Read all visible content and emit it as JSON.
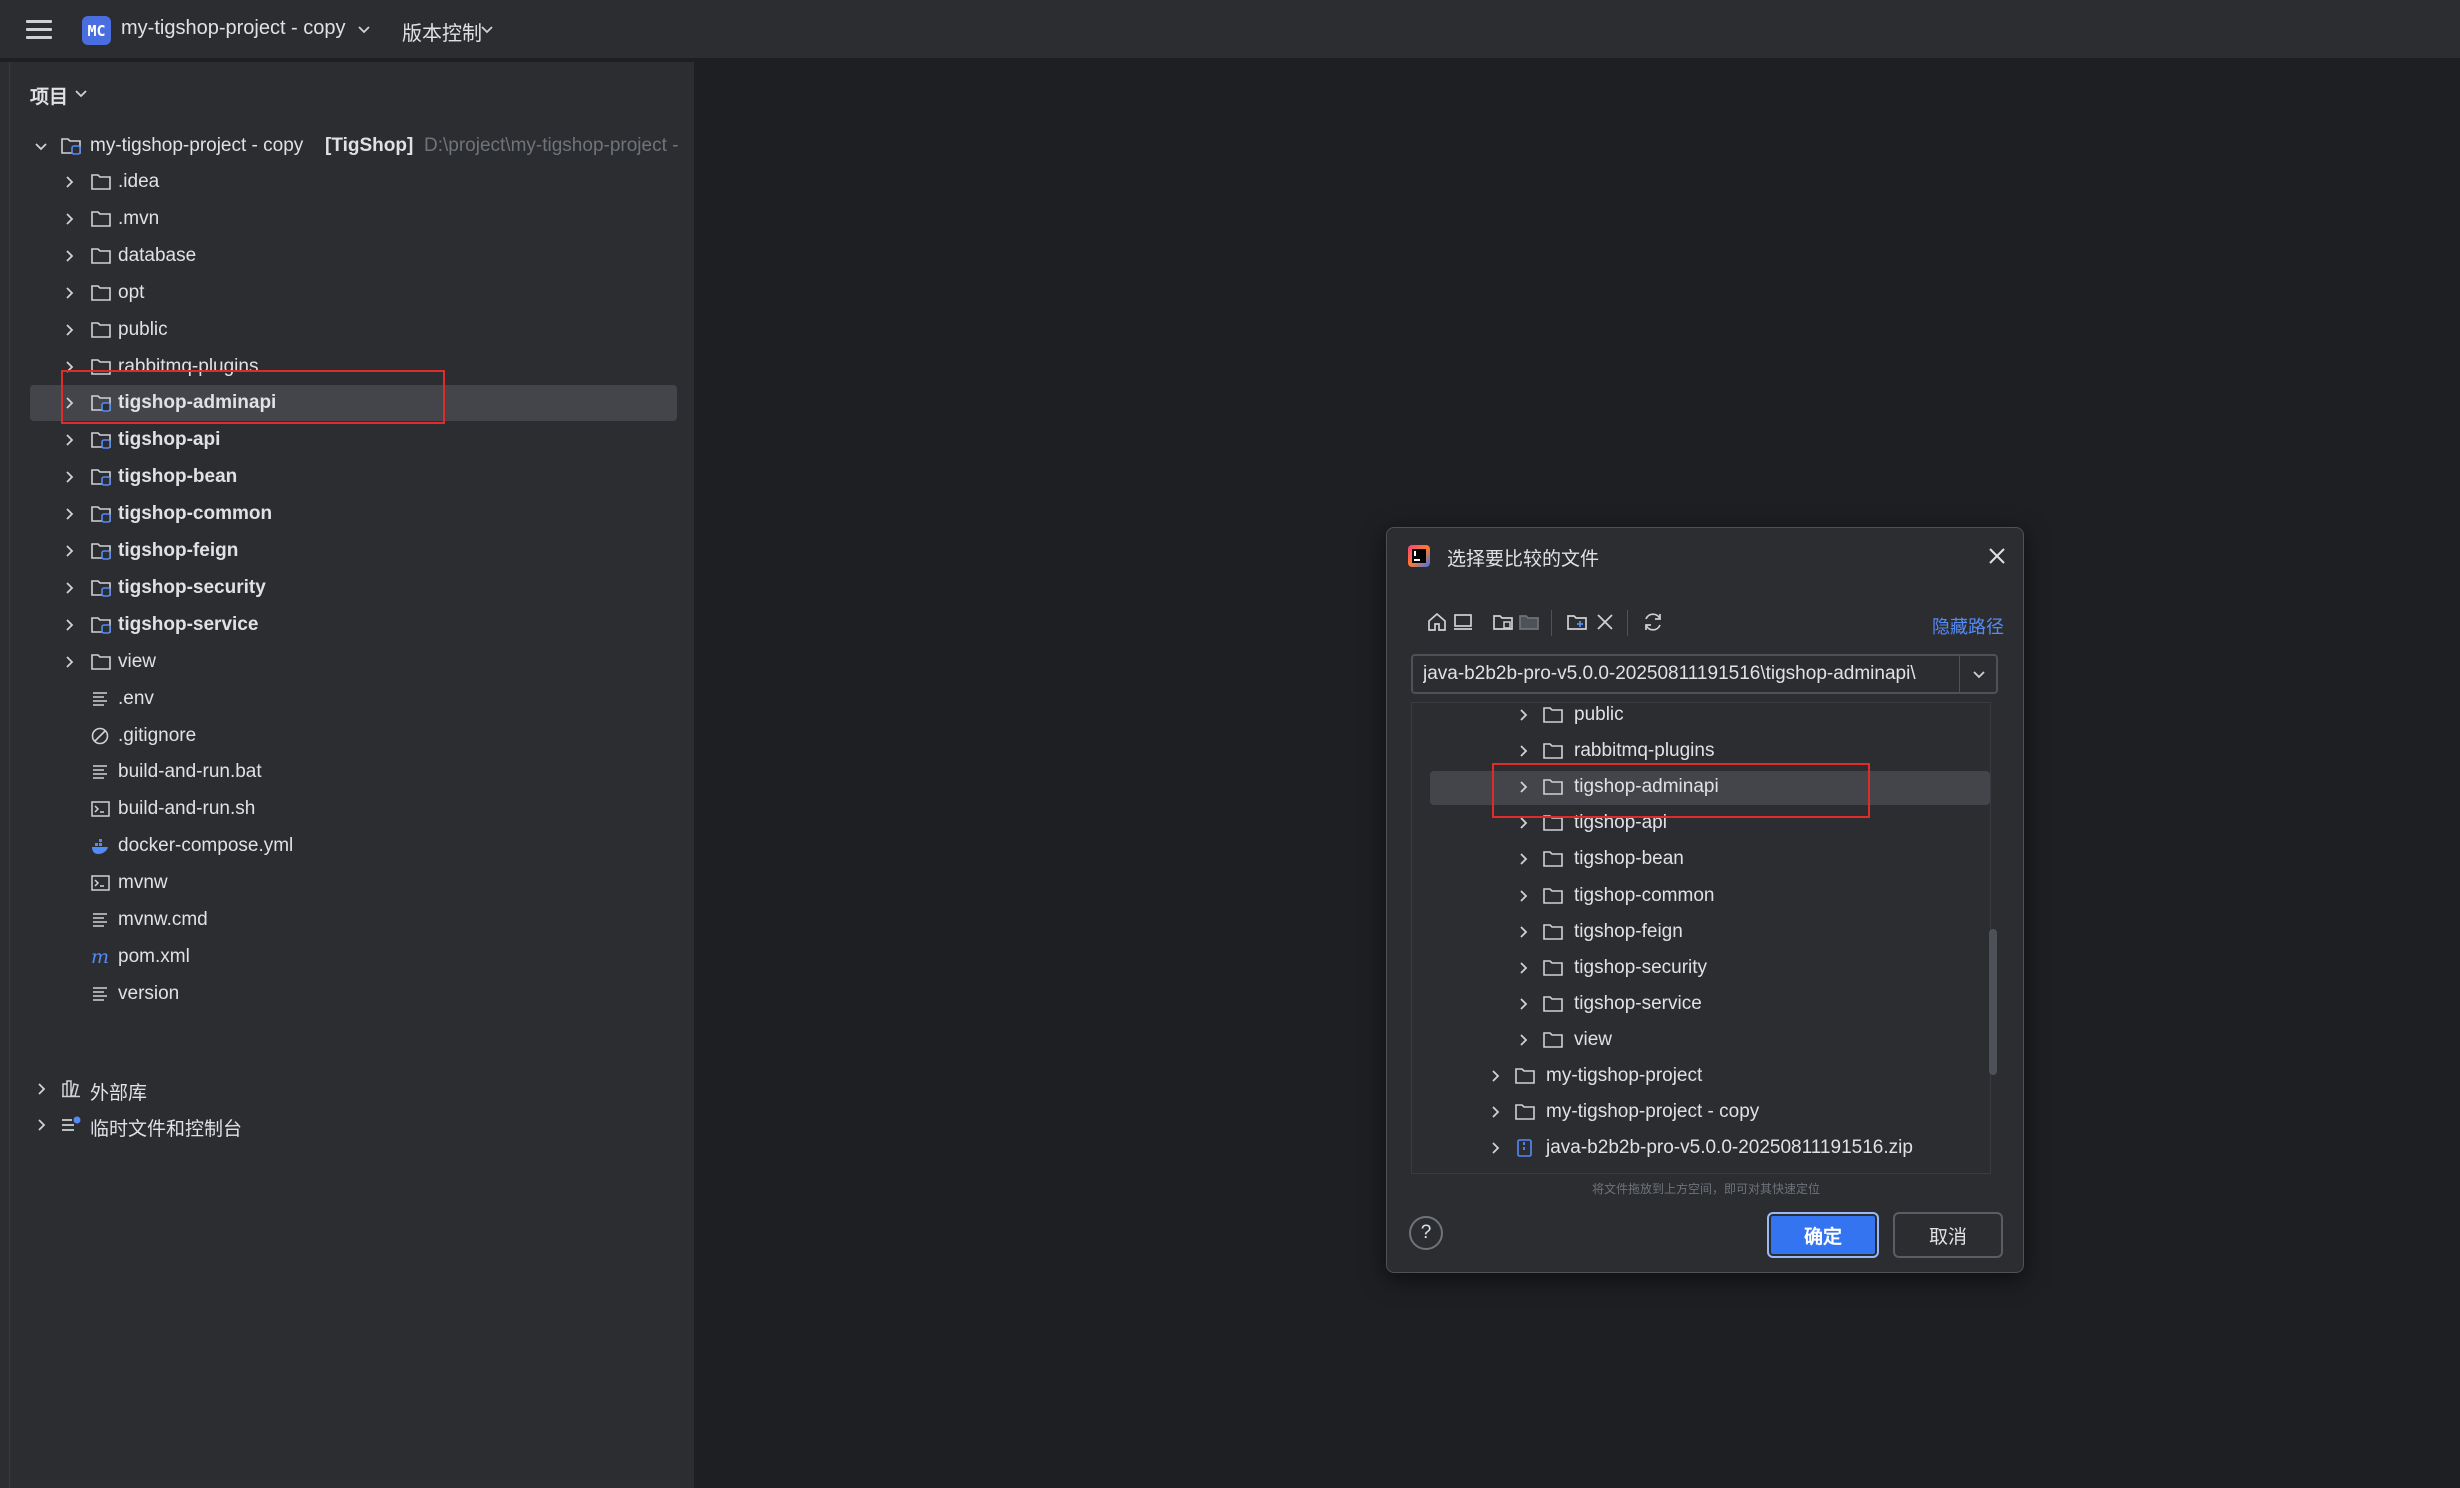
{
  "titlebar": {
    "project_badge": "MC",
    "project_name": "my-tigshop-project - copy",
    "vcs_label": "版本控制"
  },
  "project_panel": {
    "header": "项目",
    "root": {
      "label": "my-tigshop-project - copy",
      "module": "[TigShop]",
      "path_hint": "D:\\project\\my-tigshop-project -"
    },
    "items": [
      {
        "label": ".idea",
        "icon": "folder-icon"
      },
      {
        "label": ".mvn",
        "icon": "folder-icon"
      },
      {
        "label": "database",
        "icon": "folder-icon"
      },
      {
        "label": "opt",
        "icon": "folder-icon"
      },
      {
        "label": "public",
        "icon": "folder-icon"
      },
      {
        "label": "rabbitmq-plugins",
        "icon": "folder-icon"
      },
      {
        "label": "tigshop-adminapi",
        "icon": "module-folder-icon"
      },
      {
        "label": "tigshop-api",
        "icon": "module-folder-icon"
      },
      {
        "label": "tigshop-bean",
        "icon": "module-folder-icon"
      },
      {
        "label": "tigshop-common",
        "icon": "module-folder-icon"
      },
      {
        "label": "tigshop-feign",
        "icon": "module-folder-icon"
      },
      {
        "label": "tigshop-security",
        "icon": "module-folder-icon"
      },
      {
        "label": "tigshop-service",
        "icon": "module-folder-icon"
      },
      {
        "label": "view",
        "icon": "folder-icon"
      },
      {
        "label": ".env",
        "icon": "text-file-icon"
      },
      {
        "label": ".gitignore",
        "icon": "ignore-file-icon"
      },
      {
        "label": "build-and-run.bat",
        "icon": "text-file-icon"
      },
      {
        "label": "build-and-run.sh",
        "icon": "terminal-file-icon"
      },
      {
        "label": "docker-compose.yml",
        "icon": "docker-icon"
      },
      {
        "label": "mvnw",
        "icon": "terminal-file-icon"
      },
      {
        "label": "mvnw.cmd",
        "icon": "text-file-icon"
      },
      {
        "label": "pom.xml",
        "icon": "maven-icon"
      },
      {
        "label": "version",
        "icon": "text-file-icon"
      }
    ],
    "external_libs": "外部库",
    "scratches": "临时文件和控制台"
  },
  "dialog": {
    "title": "选择要比较的文件",
    "hide_path": "隐藏路径",
    "path_value": "\\java-b2b2b-pro-v5.0.0-20250811191516\\tigshop-adminapi",
    "tree": [
      {
        "label": "public"
      },
      {
        "label": "rabbitmq-plugins"
      },
      {
        "label": "tigshop-adminapi"
      },
      {
        "label": "tigshop-api"
      },
      {
        "label": "tigshop-bean"
      },
      {
        "label": "tigshop-common"
      },
      {
        "label": "tigshop-feign"
      },
      {
        "label": "tigshop-security"
      },
      {
        "label": "tigshop-service"
      },
      {
        "label": "view"
      },
      {
        "label": "my-tigshop-project"
      },
      {
        "label": "my-tigshop-project - copy"
      },
      {
        "label": "java-b2b2b-pro-v5.0.0-20250811191516.zip"
      }
    ],
    "drop_hint": "将文件拖放到上方空间，即可对其快速定位",
    "help": "?",
    "ok": "确定",
    "cancel": "取消"
  },
  "colors": {
    "background": "#1e1f22",
    "panel": "#2b2d30",
    "selection": "#43454a",
    "accent": "#3574f0",
    "link": "#548af7",
    "highlight_box": "#e02b2b"
  }
}
